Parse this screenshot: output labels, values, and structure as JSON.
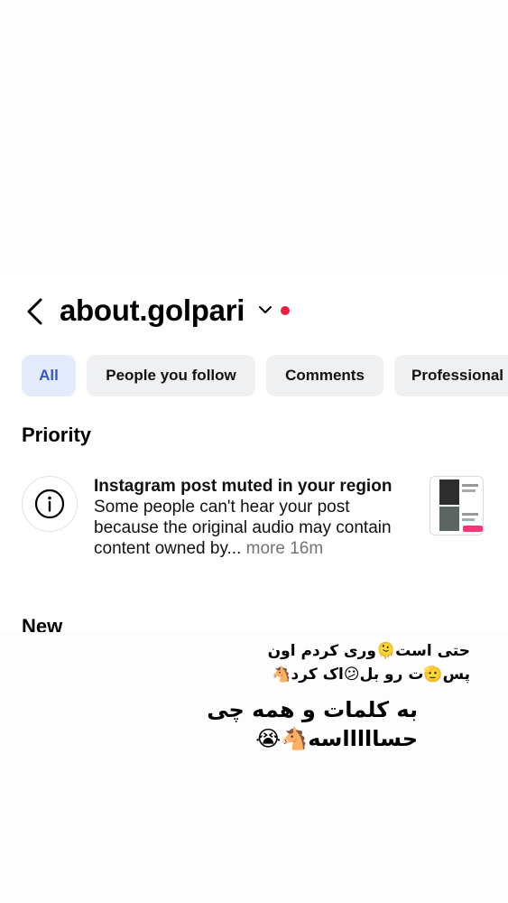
{
  "header": {
    "username": "about.golpari"
  },
  "filters": [
    {
      "label": "All",
      "active": true
    },
    {
      "label": "People you follow",
      "active": false
    },
    {
      "label": "Comments",
      "active": false
    },
    {
      "label": "Professional",
      "active": false
    }
  ],
  "sections": {
    "priority": "Priority",
    "new": "New"
  },
  "notification": {
    "title": "Instagram post muted in your region",
    "body": "Some people can't hear your post because the original audio may contain content owned by...",
    "more": "more",
    "time": "16m"
  },
  "caption": {
    "line1": "حتی است🫠وری کردم اون",
    "line2": "پس🫡ت رو بل😕اک کرد🐴",
    "line3": "به کلمات و همه چی",
    "line4": "حساااااسه🐴😭"
  },
  "colors": {
    "accent": "#3a56c9",
    "active_chip_bg": "#e4ebfb",
    "chip_bg": "#eff0f2",
    "notification_dot": "#ee1f3d"
  }
}
